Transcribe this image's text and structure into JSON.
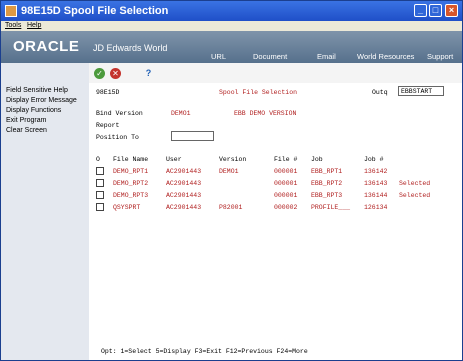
{
  "window": {
    "title": "98E15D   Spool File Selection"
  },
  "menu": {
    "tools": "Tools",
    "help": "Help"
  },
  "banner": {
    "logo": "ORACLE",
    "product": "JD Edwards World",
    "nav": [
      "URL",
      "Document",
      "Email",
      "World Resources",
      "Support"
    ]
  },
  "sidebar": {
    "items": [
      "Field Sensitive Help",
      "Display Error Message",
      "Display Functions",
      "Exit Program",
      "Clear Screen"
    ]
  },
  "toolbar": {
    "ok": "✓",
    "cancel": "✕",
    "help": "?"
  },
  "form": {
    "program_id": "98E15D",
    "screen_title": "Spool File Selection",
    "outq_label": "Outq",
    "outq_value": "EBBSTART",
    "bind_version_label": "Bind Version",
    "bind_version_value": "DEMO1",
    "bind_version_desc": "EBB DEMO VERSION",
    "report_label": "Report",
    "position_to_label": "Position To",
    "position_to_value": ""
  },
  "table": {
    "headers": [
      "O",
      "File Name",
      "User",
      "Version",
      "File #",
      "Job",
      "Job #"
    ],
    "rows": [
      {
        "file": "DEMO_RPT1",
        "user": "AC2901443",
        "version": "DEMO1",
        "filenum": "000001",
        "job": "EBB_RPT1",
        "jobnum": "136142",
        "status": ""
      },
      {
        "file": "DEMO_RPT2",
        "user": "AC2901443",
        "version": "",
        "filenum": "000001",
        "job": "EBB_RPT2",
        "jobnum": "136143",
        "status": "Selected"
      },
      {
        "file": "DEMO_RPT3",
        "user": "AC2901443",
        "version": "",
        "filenum": "000001",
        "job": "EBB_RPT3",
        "jobnum": "136144",
        "status": "Selected"
      },
      {
        "file": "QSYSPRT",
        "user": "AC2901443",
        "version": "P82001",
        "filenum": "000002",
        "job": "PROFILE___",
        "jobnum": "126134",
        "status": ""
      }
    ]
  },
  "footer": {
    "text": "Opt: 1=Select   5=Display   F3=Exit   F12=Previous   F24=More"
  }
}
